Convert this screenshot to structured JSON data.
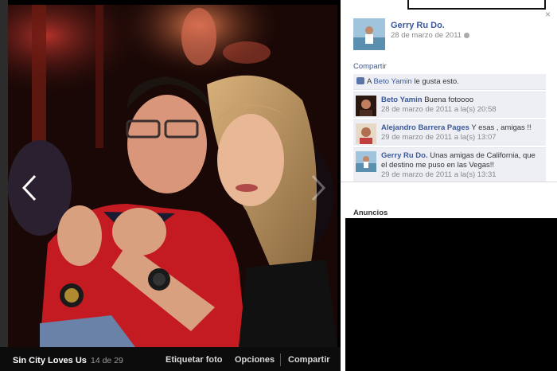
{
  "viewer": {
    "album_title": "Sin City Loves Us",
    "counter": "14 de 29",
    "tag_label": "Etiquetar foto",
    "options_label": "Opciones",
    "share_label": "Compartir"
  },
  "panel": {
    "owner_name": "Gerry Ru Do.",
    "owner_date": "28 de marzo de 2011",
    "close_label": "×",
    "share_link": "Compartir",
    "likes": {
      "prefix": "A",
      "name": "Beto Yamin",
      "suffix": "le gusta esto."
    },
    "comments": [
      {
        "author": "Beto Yamin",
        "text": "Buena fotoooo",
        "time": "28 de marzo de 2011 a la(s) 20:58"
      },
      {
        "author": "Alejandro Barrera Pages",
        "text": "Y esas , amigas !!",
        "time": "29 de marzo de 2011 a la(s) 13:07"
      },
      {
        "author": "Gerry Ru Do.",
        "text": "Unas amigas de California, que el destino me puso en las Vegas!!",
        "time": "29 de marzo de 2011 a la(s) 13:31"
      }
    ],
    "ads_title": "Anuncios"
  }
}
